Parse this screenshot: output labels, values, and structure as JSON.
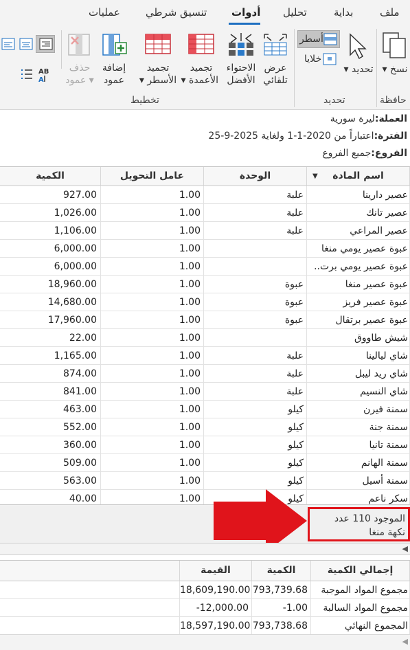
{
  "tabs": [
    "ملف",
    "بداية",
    "تحليل",
    "أدوات",
    "تنسيق شرطي",
    "عمليات"
  ],
  "active_tab": "أدوات",
  "ribbon": {
    "copy_label": "نسخ",
    "clipboard_group": "حافظة",
    "select_label": "تحديد",
    "rows_label": "أسطر",
    "cells_label": "خلايا",
    "selection_group": "تحديد",
    "auto_width_1": "عرض",
    "auto_width_2": "تلقائي",
    "best_fit_1": "الاحتواء",
    "best_fit_2": "الأفضل",
    "freeze_cols_1": "تجميد",
    "freeze_cols_2": "الأعمدة",
    "freeze_rows_1": "تجميد",
    "freeze_rows_2": "الأسطر",
    "add_col_1": "إضافة",
    "add_col_2": "عمود",
    "del_col_1": "حذف",
    "del_col_2": "عمود",
    "layout_group": "تخطيط"
  },
  "info": {
    "currency_label": "العملة:",
    "currency_value": "ليرة سورية",
    "period_label": "الفترة:",
    "period_value": "اعتباراً من 2020-1-1 ولغاية 2025-9-25",
    "branches_label": "الفروع:",
    "branches_value": "جميع الفروع"
  },
  "grid": {
    "columns": [
      "اسم المادة",
      "الوحدة",
      "عامل التحويل",
      "الكمية"
    ],
    "rows": [
      {
        "name": "عصير دارينا",
        "unit": "علبة",
        "factor": "1.00",
        "qty": "927.00"
      },
      {
        "name": "عصير تانك",
        "unit": "علبة",
        "factor": "1.00",
        "qty": "1,026.00"
      },
      {
        "name": "عصير المراعي",
        "unit": "علبة",
        "factor": "1.00",
        "qty": "1,106.00"
      },
      {
        "name": "عبوة عصير يومي منغا",
        "unit": "",
        "factor": "1.00",
        "qty": "6,000.00"
      },
      {
        "name": "عبوة عصير يومي برت..",
        "unit": "",
        "factor": "1.00",
        "qty": "6,000.00"
      },
      {
        "name": "عبوة عصير منغا",
        "unit": "عبوة",
        "factor": "1.00",
        "qty": "18,960.00"
      },
      {
        "name": "عبوة عصير فريز",
        "unit": "عبوة",
        "factor": "1.00",
        "qty": "14,680.00"
      },
      {
        "name": "عبوة عصير برتقال",
        "unit": "عبوة",
        "factor": "1.00",
        "qty": "17,960.00"
      },
      {
        "name": "شيش طاووق",
        "unit": "",
        "factor": "1.00",
        "qty": "22.00"
      },
      {
        "name": "شاي ليالينا",
        "unit": "علبة",
        "factor": "1.00",
        "qty": "1,165.00"
      },
      {
        "name": "شاي ريد ليبل",
        "unit": "علبة",
        "factor": "1.00",
        "qty": "874.00"
      },
      {
        "name": "شاي النسيم",
        "unit": "علبة",
        "factor": "1.00",
        "qty": "841.00"
      },
      {
        "name": "سمنة فيرن",
        "unit": "كيلو",
        "factor": "1.00",
        "qty": "463.00"
      },
      {
        "name": "سمنة جنة",
        "unit": "كيلو",
        "factor": "1.00",
        "qty": "552.00"
      },
      {
        "name": "سمنة تانيا",
        "unit": "كيلو",
        "factor": "1.00",
        "qty": "360.00"
      },
      {
        "name": "سمنة الهانم",
        "unit": "كيلو",
        "factor": "1.00",
        "qty": "509.00"
      },
      {
        "name": "سمنة أسيل",
        "unit": "كيلو",
        "factor": "1.00",
        "qty": "563.00"
      },
      {
        "name": "سكر ناعم",
        "unit": "كيلو",
        "factor": "1.00",
        "qty": "40.00"
      }
    ]
  },
  "footer": {
    "count_line1": "الموجود 110 عدد",
    "count_line2": "نكهة منغا"
  },
  "totals": {
    "columns": [
      "إجمالي الكمية",
      "الكمية",
      "القيمة"
    ],
    "rows": [
      {
        "label": "مجموع المواد الموجبة",
        "qty": "793,739.68",
        "value": "18,609,190.00"
      },
      {
        "label": "مجموع المواد السالبة",
        "qty": "-1.00",
        "value": "-12,000.00"
      },
      {
        "label": "المجموع النهائي",
        "qty": "793,738.68",
        "value": "18,597,190.00"
      }
    ]
  },
  "colors": {
    "accent": "#1e6fc1",
    "highlight": "#e0141b"
  }
}
